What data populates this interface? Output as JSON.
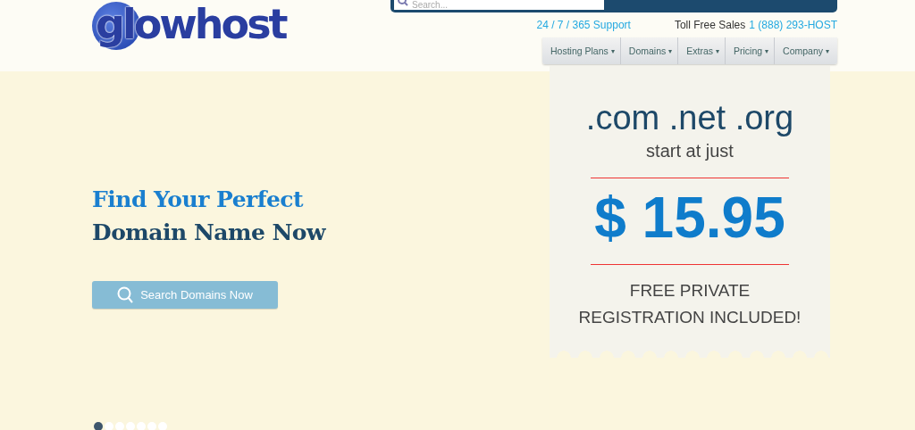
{
  "logo": {
    "text": "glowhost"
  },
  "search": {
    "placeholder": "Search..."
  },
  "support": {
    "link": "24 / 7 / 365 Support",
    "sales_label": "Toll Free Sales",
    "sales_phone": "1 (888) 293-HOST"
  },
  "nav": [
    {
      "label": "Hosting Plans",
      "caret": "▾"
    },
    {
      "label": "Domains",
      "caret": "▾"
    },
    {
      "label": "Extras",
      "caret": "▾"
    },
    {
      "label": "Pricing",
      "caret": "▾"
    },
    {
      "label": "Company",
      "caret": "▾"
    }
  ],
  "hero": {
    "headline_1": "Find Your Perfect",
    "headline_2": "Domain Name Now",
    "button": "Search Domains Now"
  },
  "ticket": {
    "tlds": ".com .net .org",
    "intro": "start at just",
    "price": "$ 15.95",
    "note_1": "FREE PRIVATE",
    "note_2": "REGISTRATION INCLUDED!"
  },
  "slides": [
    {
      "selected": true
    },
    {
      "selected": false
    },
    {
      "selected": false
    },
    {
      "selected": false
    },
    {
      "selected": false
    },
    {
      "selected": false
    },
    {
      "selected": false
    }
  ]
}
